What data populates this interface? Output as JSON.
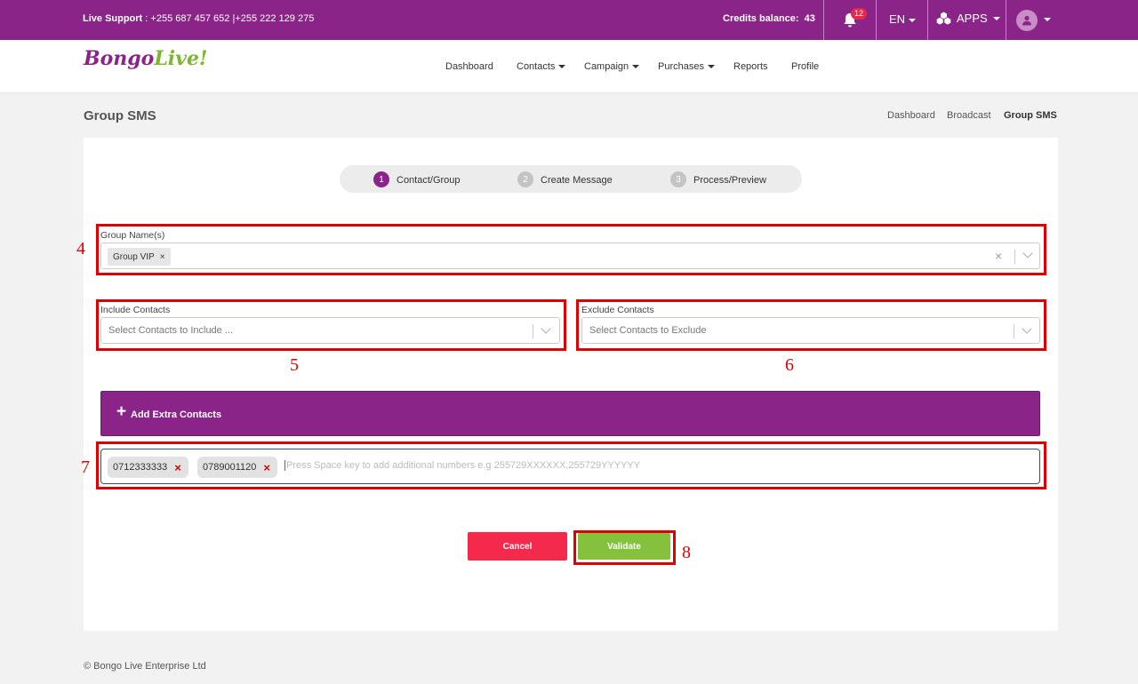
{
  "topbar": {
    "support_label": "Live Support",
    "support_numbers": ": +255 687 457 652 |+255 222 129 275",
    "credits_label": "Credits balance:",
    "credits_value": "43",
    "notifications_count": "12",
    "language": "EN",
    "apps_label": "APPS"
  },
  "brand": {
    "part1": "Bongo",
    "part2": "Live!"
  },
  "nav": {
    "dashboard": "Dashboard",
    "contacts": "Contacts",
    "campaign": "Campaign",
    "purchases": "Purchases",
    "reports": "Reports",
    "profile": "Profile"
  },
  "page": {
    "title": "Group SMS",
    "breadcrumb": [
      "Dashboard",
      "Broadcast",
      "Group SMS"
    ]
  },
  "stepper": [
    {
      "num": "1",
      "label": "Contact/Group"
    },
    {
      "num": "2",
      "label": "Create Message"
    },
    {
      "num": "3",
      "label": "Process/Preview"
    }
  ],
  "form": {
    "group_label": "Group Name(s)",
    "group_selected": "Group VIP",
    "include_label": "Include Contacts",
    "include_placeholder": "Select Contacts to Include ...",
    "exclude_label": "Exclude Contacts",
    "exclude_placeholder": "Select Contacts to Exclude",
    "extra_label": "Add Extra Contacts",
    "extra_numbers": [
      "0712333333",
      "0789001120"
    ],
    "extra_placeholder": "Press Space key to add additional numbers e.g 255729XXXXXX,255729YYYYYY",
    "cancel_label": "Cancel",
    "validate_label": "Validate"
  },
  "annotations": [
    "4",
    "5",
    "6",
    "7",
    "8"
  ],
  "footer": "© Bongo Live Enterprise Ltd",
  "colors": {
    "brand_purple": "#8a2488",
    "cancel_red": "#f5294b",
    "validate_green": "#85c13d",
    "annotation_red": "#e00000"
  },
  "icons": [
    "bell-icon",
    "apps-icon",
    "user-icon",
    "plus-icon",
    "close-icon",
    "chevron-down-icon"
  ]
}
